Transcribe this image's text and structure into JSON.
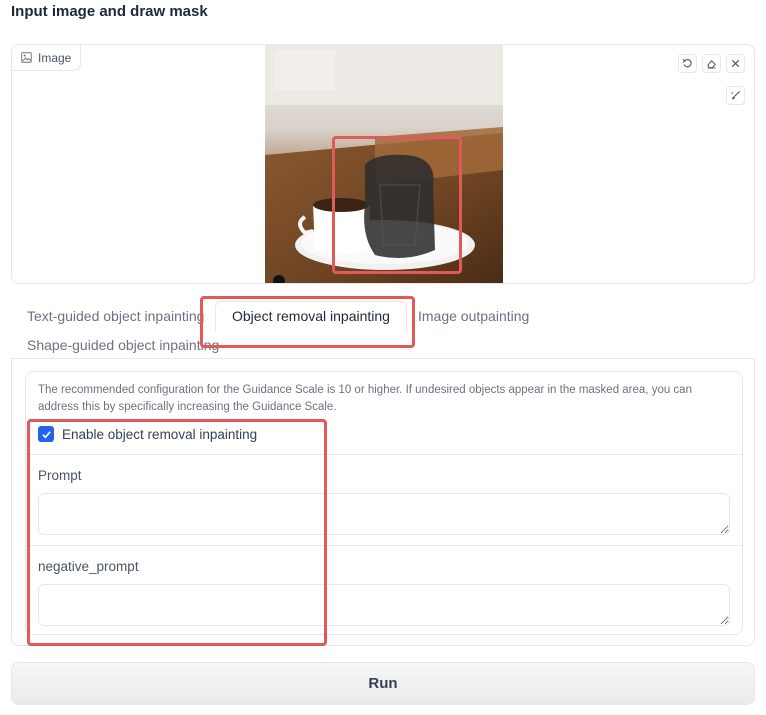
{
  "section": {
    "title": "Input image and draw mask"
  },
  "image_panel": {
    "label": "Image",
    "icons": [
      "image-icon",
      "undo-icon",
      "eraser-icon",
      "close-icon",
      "brush-icon"
    ]
  },
  "tabs": [
    {
      "label": "Text-guided object inpainting",
      "active": false
    },
    {
      "label": "Object removal inpainting",
      "active": true
    },
    {
      "label": "Image outpainting",
      "active": false
    },
    {
      "label": "Shape-guided object inpainting",
      "active": false
    }
  ],
  "object_removal": {
    "hint": "The recommended configuration for the Guidance Scale is 10 or higher. If undesired objects appear in the masked area, you can address this by specifically increasing the Guidance Scale.",
    "enable_label": "Enable object removal inpainting",
    "enable_checked": true,
    "prompt_label": "Prompt",
    "prompt_value": "",
    "negative_label": "negative_prompt",
    "negative_value": ""
  },
  "run_label": "Run",
  "colors": {
    "accent": "#2563eb",
    "highlight": "#e05a5a",
    "border": "#e5e7eb"
  }
}
